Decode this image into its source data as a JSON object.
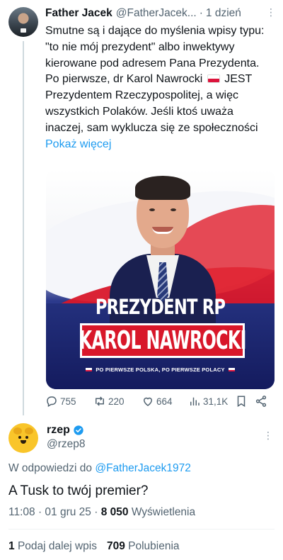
{
  "tweet1": {
    "author_name": "Father Jacek",
    "author_handle": "@FatherJacek...",
    "dot": "·",
    "time": "1 dzień",
    "more": "⋮",
    "text_before_flag": "Smutne są i dające do myślenia wpisy typu: \"to nie mój prezydent\" albo inwektywy kierowane pod adresem Pana Prezydenta. Po pierwsze, dr Karol Nawrocki",
    "text_after_flag": " JEST Prezydentem Rzeczypospolitej, a więc wszystkich Polaków. Jeśli ktoś uważa inaczej, sam wyklucza się ze społeczności ",
    "show_more": "Pokaż więcej",
    "poster": {
      "title": "PREZYDENT RP",
      "name": "KAROL NAWROCKI",
      "slogan": "PO PIERWSZE POLSKA, PO PIERWSZE POLACY"
    },
    "actions": {
      "replies": "755",
      "retweets": "220",
      "likes": "664",
      "views": "31,1K"
    }
  },
  "tweet2": {
    "author_name": "rzep",
    "author_handle": "@rzep8",
    "more": "⋮",
    "reply_prefix": "W odpowiedzi do",
    "reply_target": "@FatherJacek1972",
    "text": "A Tusk to twój premier?",
    "time": "11:08 · 01 gru 25 ·",
    "views_count": "8 050",
    "views_label": "Wyświetlenia",
    "reposts_count": "1",
    "reposts_label": "Podaj dalej wpis",
    "likes_count": "709",
    "likes_label": "Polubienia"
  },
  "colors": {
    "link": "#1d9bf0",
    "secondary_text": "#536471",
    "poster_red": "#d8172a",
    "poster_navy": "#1b2470",
    "verified_blue": "#1d9bf0"
  },
  "icons": [
    "reply-icon",
    "retweet-icon",
    "like-icon",
    "views-icon",
    "bookmark-icon",
    "share-icon",
    "verified-icon",
    "more-icon"
  ]
}
